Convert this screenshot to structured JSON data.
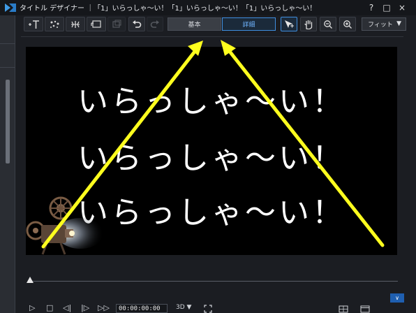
{
  "window": {
    "title": "タイトル デザイナー ｜「1」いらっしゃ〜い！「1」いらっしゃ〜い！「1」いらっしゃ〜い！",
    "help_glyph": "?",
    "maximize_glyph": "□",
    "close_glyph": "×"
  },
  "toolbar": {
    "tabs": [
      {
        "label": "基本",
        "active": false
      },
      {
        "label": "詳細",
        "active": true
      }
    ],
    "zoom_select": "フィット",
    "zoom_caret": "▼"
  },
  "canvas": {
    "caption_lines": [
      "いらっしゃ〜い！",
      "いらっしゃ〜い！",
      "いらっしゃ〜い！"
    ],
    "background": "#000000",
    "annotation_arrow_color": "#ffff1e"
  },
  "timeline": {
    "expand_glyph": "∨"
  },
  "playback": {
    "timecode": "00:00:00:00",
    "mode_3d": "3D ▼",
    "play_glyph": "▷",
    "stop_glyph": "□",
    "prev_glyph": "◁|",
    "next_glyph": "|▷",
    "ff_glyph": "▷▷"
  },
  "colors": {
    "accent_blue": "#3f8fe0",
    "panel": "#1b1d22"
  }
}
